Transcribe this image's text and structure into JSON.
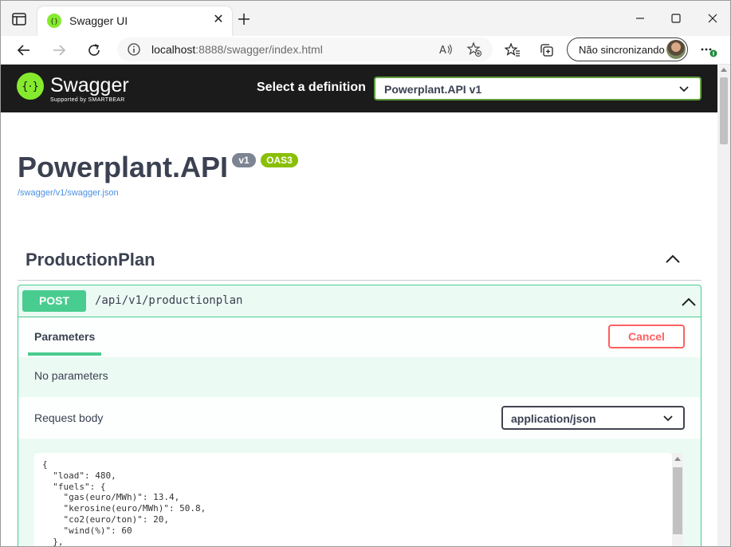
{
  "browser": {
    "tab_title": "Swagger UI",
    "address": {
      "host": "localhost",
      "path": ":8888/swagger/index.html"
    },
    "profile_label": "Não sincronizando"
  },
  "topbar": {
    "logo_text": "Swagger",
    "logo_sub": "Supported by SMARTBEAR",
    "select_label": "Select a definition",
    "selected_definition": "Powerplant.API v1"
  },
  "info": {
    "title": "Powerplant.API",
    "version_badge": "v1",
    "oas_badge": "OAS3",
    "spec_url": "/swagger/v1/swagger.json"
  },
  "tag": {
    "name": "ProductionPlan"
  },
  "operation": {
    "method": "POST",
    "path": "/api/v1/productionplan",
    "params_tab": "Parameters",
    "cancel_label": "Cancel",
    "no_params": "No parameters",
    "request_body_label": "Request body",
    "content_type": "application/json",
    "body_text": "{\n  \"load\": 480,\n  \"fuels\": {\n    \"gas(euro/MWh)\": 13.4,\n    \"kerosine(euro/MWh)\": 50.8,\n    \"co2(euro/ton)\": 20,\n    \"wind(%)\": 60\n  },"
  },
  "colors": {
    "post_green": "#49cc90",
    "topbar_bg": "#1b1b1b",
    "cancel_red": "#ff6060",
    "badge_grey": "#7d8492",
    "oas_green": "#89bf04"
  }
}
